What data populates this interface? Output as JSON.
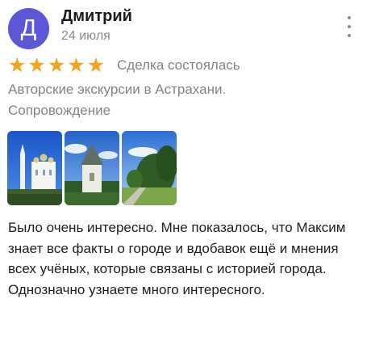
{
  "author": {
    "initial": "Д",
    "name": "Дмитрий",
    "date": "24 июля",
    "avatar_color": "#5b57d6"
  },
  "rating": {
    "stars": 5,
    "star_color": "#f5a31f",
    "deal_status": "Сделка состоялась"
  },
  "service": {
    "line1": "Авторские экскурсии в Астрахани.",
    "line2": "Сопровождение"
  },
  "photos": [
    {
      "icon": "cathedral-photo"
    },
    {
      "icon": "kremlin-tower-photo"
    },
    {
      "icon": "park-trees-photo"
    }
  ],
  "review": {
    "text": "Было очень интересно. Мне показалось, что Максим знает все факты о городе и вдобавок ещё и мнения всех учёных, которые связаны с историей города. Однозначно узнаете много интересного."
  },
  "menu_icon": "more-vertical-icon"
}
